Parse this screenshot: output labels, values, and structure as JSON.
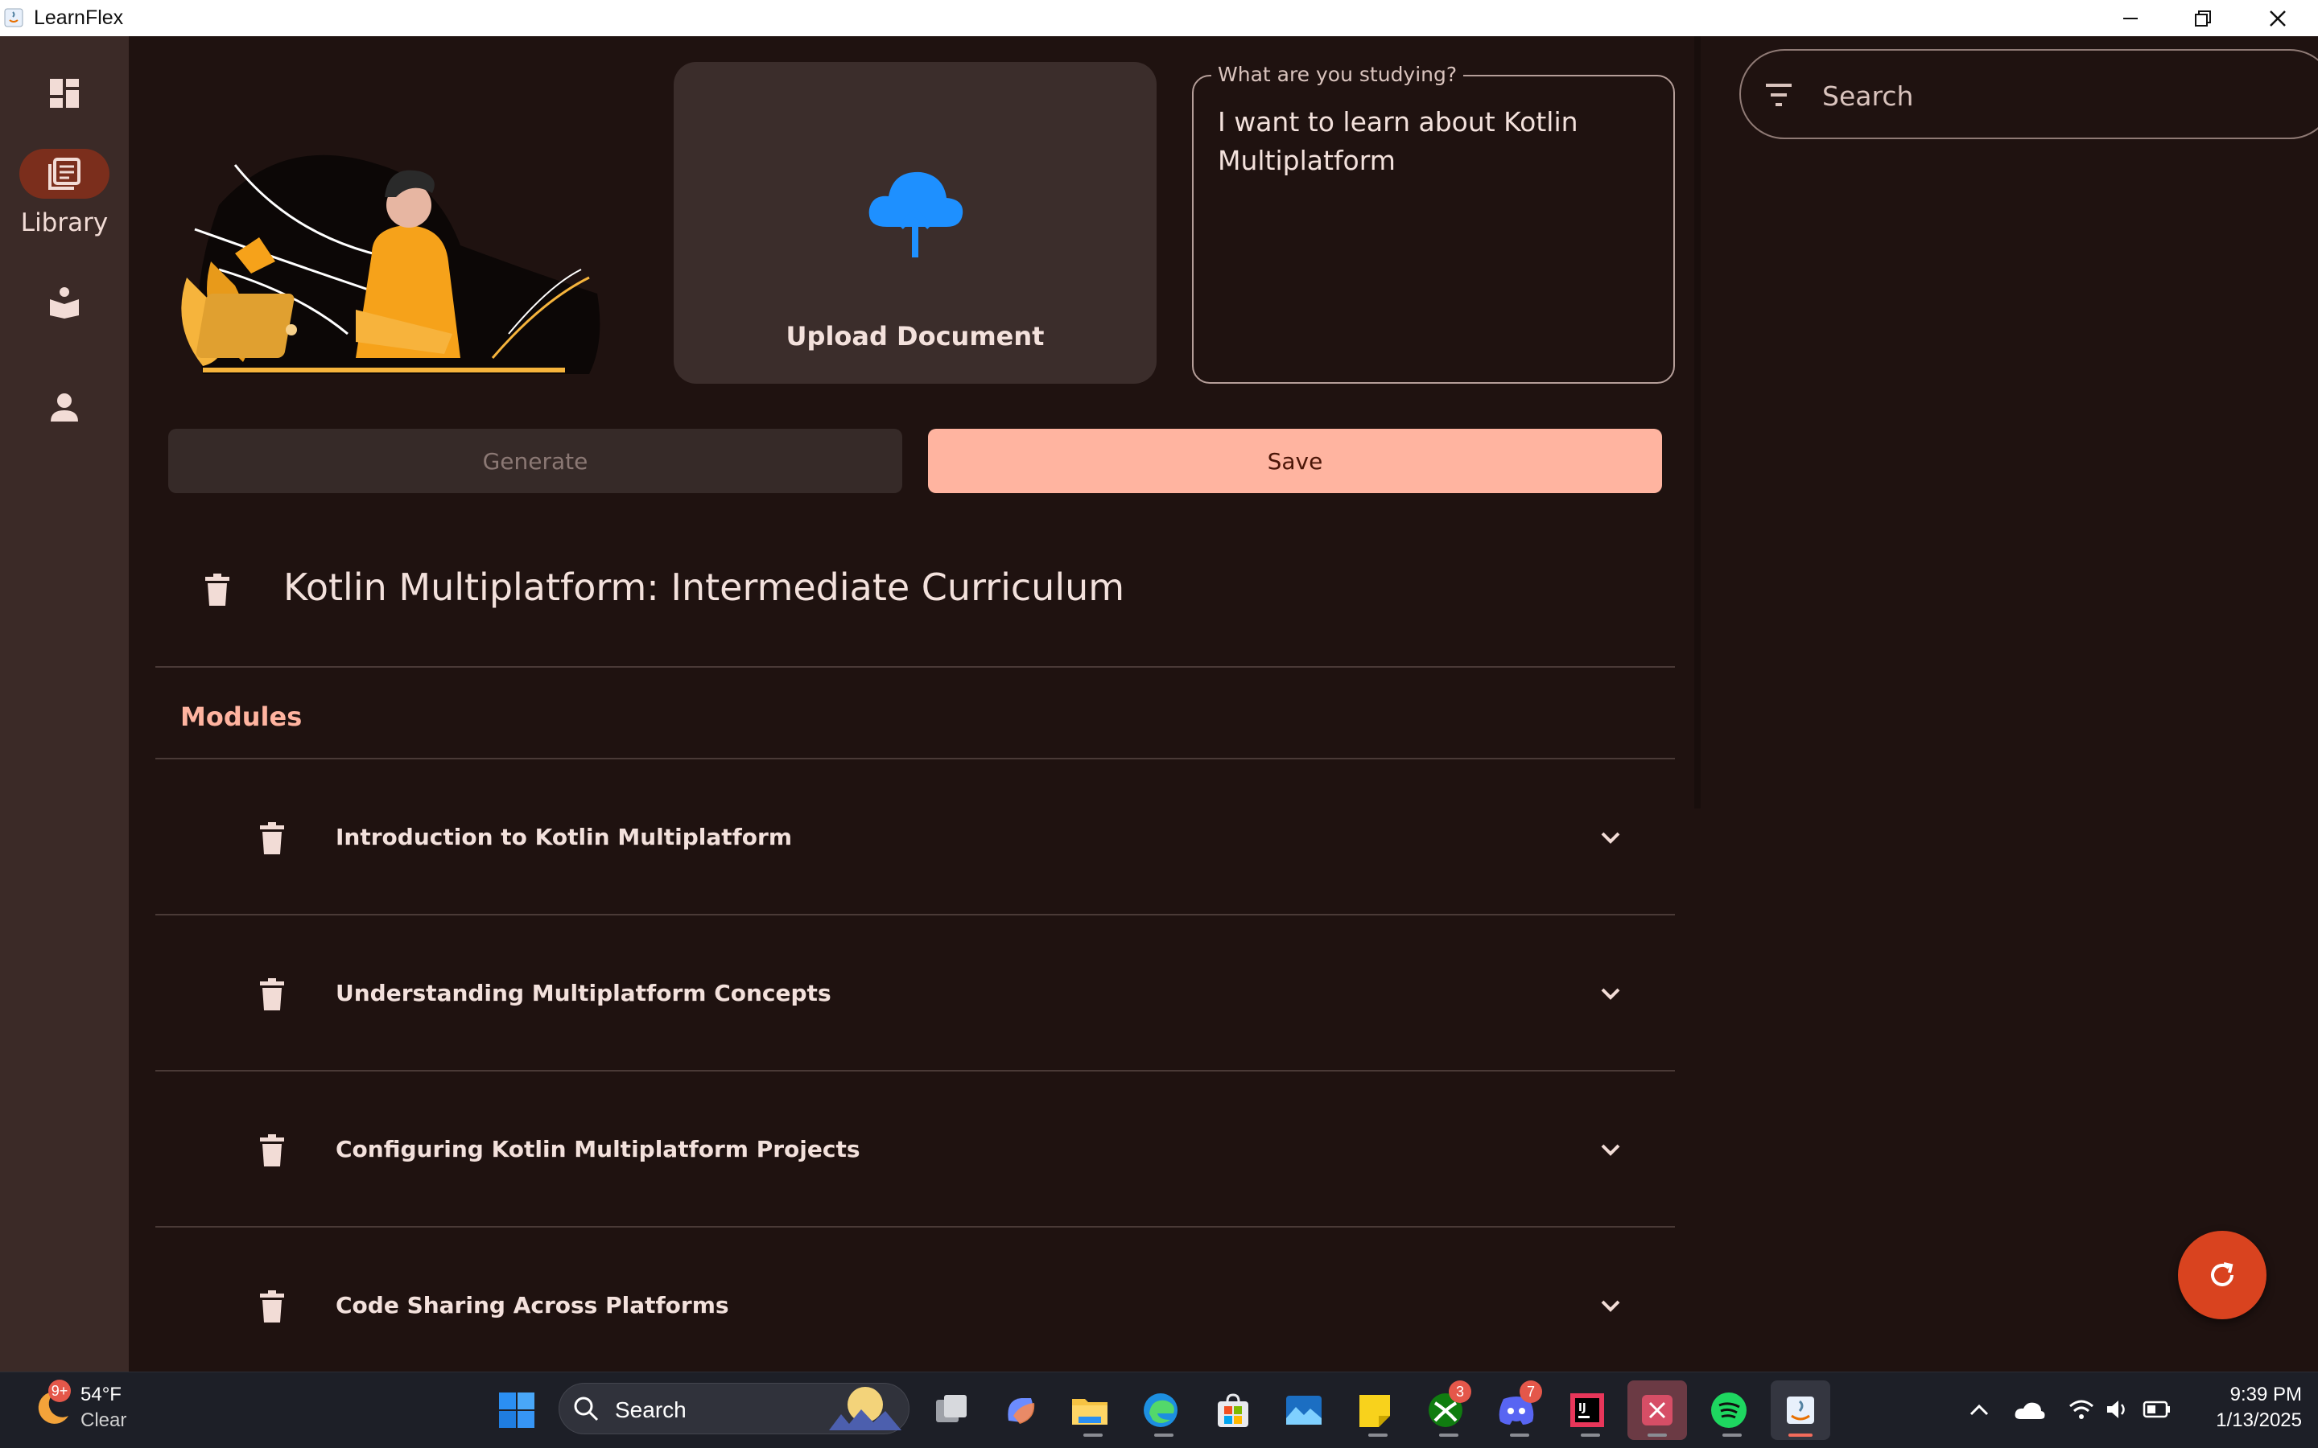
{
  "window": {
    "title": "LearnFlex"
  },
  "rail": {
    "items": [
      {
        "name": "dashboard",
        "label": ""
      },
      {
        "name": "library",
        "label": "Library",
        "active": true
      },
      {
        "name": "study",
        "label": ""
      },
      {
        "name": "profile",
        "label": ""
      }
    ]
  },
  "upload": {
    "label": "Upload Document"
  },
  "study_field": {
    "legend": "What are you studying?",
    "value": "I want to learn about Kotlin Multiplatform"
  },
  "actions": {
    "generate_label": "Generate",
    "save_label": "Save"
  },
  "course": {
    "title": "Kotlin Multiplatform: Intermediate Curriculum",
    "modules_label": "Modules",
    "modules": [
      "Introduction to Kotlin Multiplatform",
      "Understanding Multiplatform Concepts",
      "Configuring Kotlin Multiplatform Projects",
      "Code Sharing Across Platforms"
    ]
  },
  "search": {
    "placeholder": "Search"
  },
  "colors": {
    "accent": "#ffb4a0",
    "fab": "#d9431f",
    "background": "#1f1210",
    "rail": "#3b2a27",
    "upload_icon": "#1e90ff"
  },
  "taskbar": {
    "weather": {
      "temp": "54°F",
      "condition": "Clear",
      "badge": "9+"
    },
    "search_label": "Search",
    "badges": {
      "xbox": "3",
      "discord": "7"
    },
    "time": "9:39 PM",
    "date": "1/13/2025"
  }
}
